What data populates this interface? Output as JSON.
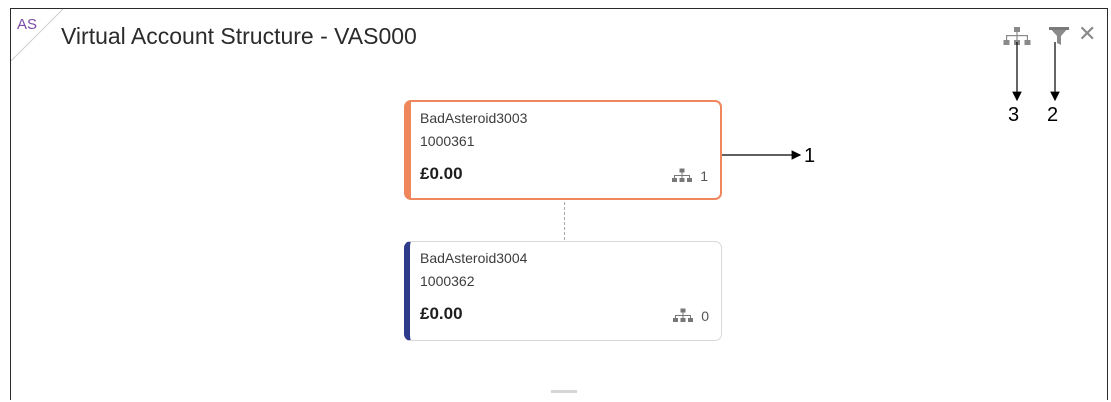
{
  "header": {
    "corner_badge": "AS",
    "title": "Virtual Account Structure - VAS000"
  },
  "toolbar": {
    "icons": [
      "hierarchy-icon",
      "filter-icon",
      "close-icon"
    ],
    "close_glyph": "✕"
  },
  "nodes": [
    {
      "name": "BadAsteroid3003",
      "number": "1000361",
      "balance": "£0.00",
      "children_count": "1",
      "accent": "#f0875c"
    },
    {
      "name": "BadAsteroid3004",
      "number": "1000362",
      "balance": "£0.00",
      "children_count": "0",
      "accent": "#2e3b8a"
    }
  ],
  "annotations": {
    "label_1": "1",
    "label_2": "2",
    "label_3": "3"
  },
  "colors": {
    "selected_border": "#f0875c",
    "node_accent": "#2e3b8a",
    "badge_text": "#7b4aa6"
  }
}
